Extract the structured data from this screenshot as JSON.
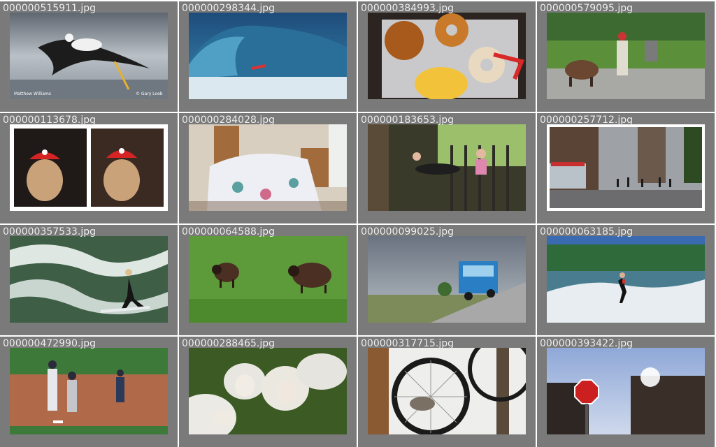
{
  "gallery": {
    "tiles": [
      {
        "filename": "000000515911.jpg",
        "subject": "seagull-photo",
        "photo_caption_left": "Matthew Williams",
        "photo_caption_right": "© Gary Loeb"
      },
      {
        "filename": "000000298344.jpg",
        "subject": "surfer-wave-photo"
      },
      {
        "filename": "000000384993.jpg",
        "subject": "donuts-photo"
      },
      {
        "filename": "000000579095.jpg",
        "subject": "cow-parade-photo"
      },
      {
        "filename": "000000113678.jpg",
        "subject": "beagle-hats-photo"
      },
      {
        "filename": "000000284028.jpg",
        "subject": "bedroom-photo"
      },
      {
        "filename": "000000183653.jpg",
        "subject": "porch-kids-photo"
      },
      {
        "filename": "000000257712.jpg",
        "subject": "city-street-photo"
      },
      {
        "filename": "000000357533.jpg",
        "subject": "river-surfer-photo"
      },
      {
        "filename": "000000064588.jpg",
        "subject": "sheep-field-photo"
      },
      {
        "filename": "000000099025.jpg",
        "subject": "blue-van-photo"
      },
      {
        "filename": "000000063185.jpg",
        "subject": "waterskier-photo"
      },
      {
        "filename": "000000472990.jpg",
        "subject": "baseball-photo"
      },
      {
        "filename": "000000288465.jpg",
        "subject": "white-sheep-photo"
      },
      {
        "filename": "000000317715.jpg",
        "subject": "bicycle-cat-photo"
      },
      {
        "filename": "000000393422.jpg",
        "subject": "stop-sign-photo"
      }
    ]
  }
}
